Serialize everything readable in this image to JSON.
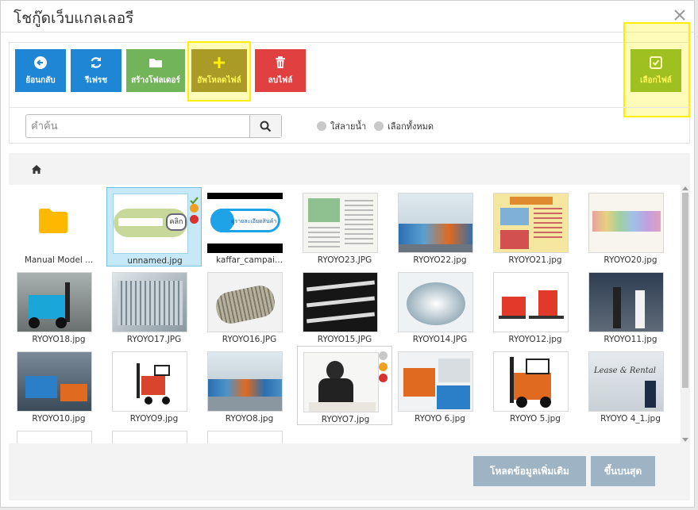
{
  "dialog": {
    "title": "โชกู๊ดเว็บแกลเลอรี"
  },
  "toolbar": {
    "buttons": [
      {
        "label": "ย้อนกลับ",
        "icon": "arrow-left-circle-icon",
        "color": "#1f86d6"
      },
      {
        "label": "รีเฟรช",
        "icon": "refresh-icon",
        "color": "#1f86d6"
      },
      {
        "label": "สร้างโฟลเดอร์",
        "icon": "folder-icon",
        "color": "#72b45a"
      },
      {
        "label": "อัพโหลดไฟล์",
        "icon": "plus-icon",
        "color": "#8a7b36"
      },
      {
        "label": "ลบไฟล์",
        "icon": "trash-icon",
        "color": "#e04040"
      },
      {
        "label": "เลือกไฟล์",
        "icon": "check-square-icon",
        "color": "#7aae2e"
      }
    ],
    "search_placeholder": "คำค้น",
    "options": [
      "ใส่ลายน้ำ",
      "เลือกทั้งหมด"
    ]
  },
  "files": [
    {
      "name": "Manual Model ...",
      "type": "folder"
    },
    {
      "name": "unnamed.jpg",
      "type": "image",
      "selected": true
    },
    {
      "name": "kaffar_campai...",
      "type": "image"
    },
    {
      "name": "RYOYO23.JPG",
      "type": "image"
    },
    {
      "name": "RYOYO22.jpg",
      "type": "image"
    },
    {
      "name": "RYOYO21.jpg",
      "type": "image"
    },
    {
      "name": "RYOYO20.jpg",
      "type": "image"
    },
    {
      "name": "RYOYO18.jpg",
      "type": "image"
    },
    {
      "name": "RYOYO17.JPG",
      "type": "image"
    },
    {
      "name": "RYOYO16.JPG",
      "type": "image"
    },
    {
      "name": "RYOYO15.JPG",
      "type": "image"
    },
    {
      "name": "RYOYO14.JPG",
      "type": "image"
    },
    {
      "name": "RYOYO12.jpg",
      "type": "image"
    },
    {
      "name": "RYOYO11.jpg",
      "type": "image"
    },
    {
      "name": "RYOYO10.jpg",
      "type": "image"
    },
    {
      "name": "RYOYO9.jpg",
      "type": "image"
    },
    {
      "name": "RYOYO8.jpg",
      "type": "image"
    },
    {
      "name": "RYOYO7.jpg",
      "type": "image",
      "hovered": true
    },
    {
      "name": "RYOYO 6.jpg",
      "type": "image"
    },
    {
      "name": "RYOYO 5.jpg",
      "type": "image"
    },
    {
      "name": "RYOYO 4_1.jpg",
      "type": "image"
    }
  ],
  "thumb_texts": {
    "unnamed": "คลิก",
    "kaffar": "ดูรายละเอียดสินค้า",
    "ryoyo4": "Lease & Rental"
  },
  "footer": {
    "load_more": "โหลดข้อมูลเพิ่มเติม",
    "to_top": "ขึ้นบนสุด"
  }
}
